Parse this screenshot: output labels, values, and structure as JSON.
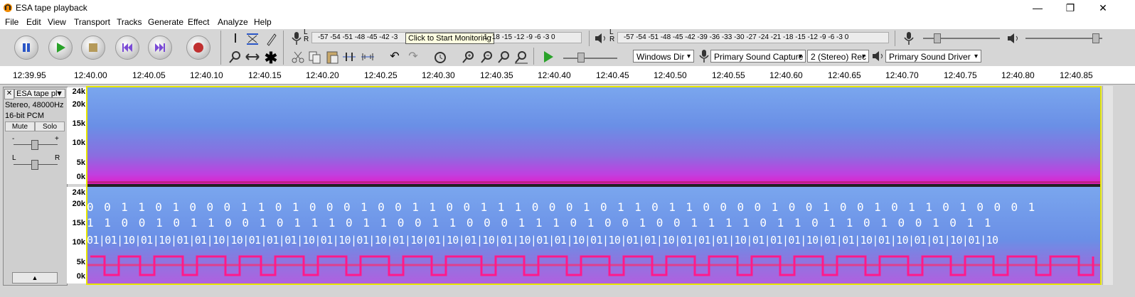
{
  "window": {
    "title": "ESA tape playback",
    "minimize": "—",
    "maximize": "❐",
    "close": "✕"
  },
  "menu": [
    "File",
    "Edit",
    "View",
    "Transport",
    "Tracks",
    "Generate",
    "Effect",
    "Analyze",
    "Help"
  ],
  "meters": {
    "record_scale": "-57 -54 -51 -48 -45 -42 -3",
    "record_tooltip": "Click to Start Monitoring",
    "record_scale_tail": "1 -18 -15 -12 -9 -6 -3 0",
    "play_scale": "-57 -54 -51 -48 -45 -42 -39 -36 -33 -30 -27 -24 -21 -18 -15 -12 -9 -6 -3 0",
    "lr_label_top": "L",
    "lr_label_bottom": "R"
  },
  "devices": {
    "host": "Windows Dir",
    "recording_device": "Primary Sound Capture",
    "channels": "2 (Stereo) Rec",
    "playback_device": "Primary Sound Driver"
  },
  "ruler_labels": [
    "12:39.95",
    "12:40.00",
    "12:40.05",
    "12:40.10",
    "12:40.15",
    "12:40.20",
    "12:40.25",
    "12:40.30",
    "12:40.35",
    "12:40.40",
    "12:40.45",
    "12:40.50",
    "12:40.55",
    "12:40.60",
    "12:40.65",
    "12:40.70",
    "12:40.75",
    "12:40.80",
    "12:40.85"
  ],
  "track": {
    "close": "✕",
    "name": "ESA tape pl",
    "format": "Stereo, 48000Hz",
    "bitdepth": "16-bit PCM",
    "mute": "Mute",
    "solo": "Solo",
    "gain_minus": "-",
    "gain_plus": "+",
    "pan_left": "L",
    "pan_right": "R",
    "collapse": "▲"
  },
  "freq_labels": [
    "24k",
    "20k",
    "15k",
    "10k",
    "5k",
    "0k"
  ],
  "bits": {
    "row1": "0 0 1 1 0 1 0 0 0 1 1 0 1 0 0 0 1 0 0 1 1 0 0 1 1 1 0 0 0 1 0 1 1 0 1 1 0 0 0 0 1 0 0 1 0 0 1 0 1 1 0 1 0 0 0 1",
    "row2": "1 1 0 0 1 0 1 1 0 0 1 0 1 1 1 0 1 1 0 0 1 1 0 0 0 1 1 1 0 1 0 0 1 0 0 1 1 1 1 0 1 1 0 1 1 0 1 0 0 1 0 1 1",
    "row3": "01|01|10|01|10|01|01|10|10|01|01|01|10|01|10|01|10|01|10|01|10|01|10|01|10|01|01|10|01|10|01|01|10|01|01|01|10|01|01|01|10|01|01|10|01|10|01|01|10|01|10"
  },
  "colors": {
    "spectrogram_bg": "#5a8fe0",
    "signal": "#ff2a6a",
    "selection_border": "#e6e600"
  }
}
